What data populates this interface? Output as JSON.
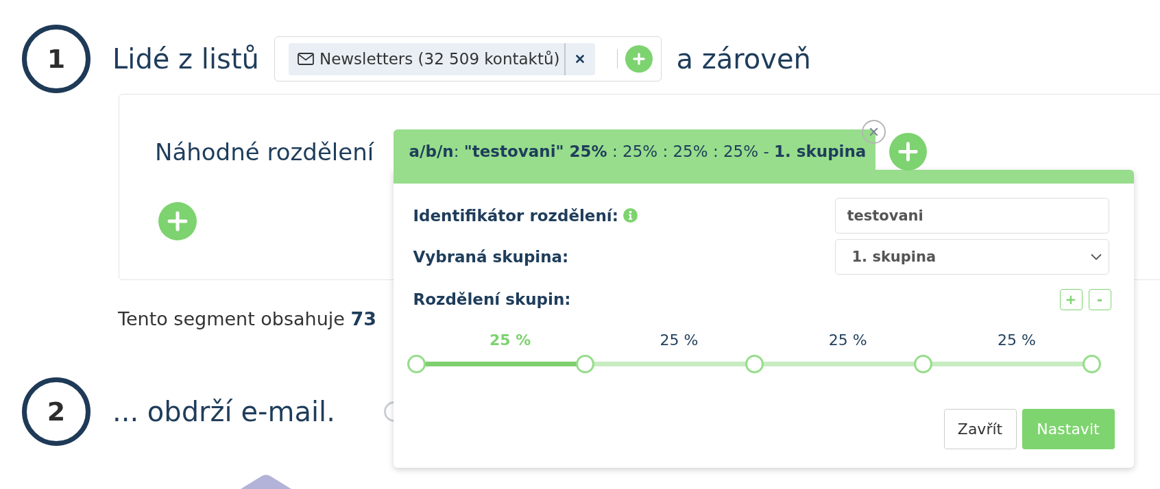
{
  "step_1": {
    "number": "1",
    "title": "Lidé z listů",
    "lists_field": {
      "tags": [
        {
          "label": "Newsletters (32 509 kontaktů)"
        }
      ]
    },
    "conjunction": "a zároveň"
  },
  "condition_card": {
    "title": "Náhodné rozdělení",
    "split_popup": {
      "tab_label": "**a/b/n**: **\"testovani\" 25%** : 25% : 25% : 25% - **1. skupina**",
      "fields": [
        {
          "kind": "text",
          "label": "Identifikátor rozdělení:",
          "info": true,
          "value": "testovani"
        },
        {
          "kind": "select",
          "label": "Vybraná skupina:",
          "info": false,
          "value": "1. skupina"
        }
      ],
      "split": {
        "label": "Rozdělení skupin:",
        "add_label": "+",
        "remove_label": "-",
        "segments": [
          {
            "label": "25 %",
            "selected": true
          },
          {
            "label": "25 %",
            "selected": false
          },
          {
            "label": "25 %",
            "selected": false
          },
          {
            "label": "25 %",
            "selected": false
          }
        ],
        "handles": [
          {
            "level": 0
          },
          {
            "level": 0.25
          },
          {
            "level": 0.5
          },
          {
            "level": 0.75
          },
          {
            "level": 1
          }
        ]
      },
      "buttons": [
        {
          "kind": "secondary",
          "label": "Zavřít"
        },
        {
          "kind": "primary",
          "label": "Nastavit"
        }
      ]
    }
  },
  "segment_summary": "Tento segment obsahuje **73**",
  "step_2": {
    "number": "2",
    "title": "... obdrží e-mail."
  }
}
